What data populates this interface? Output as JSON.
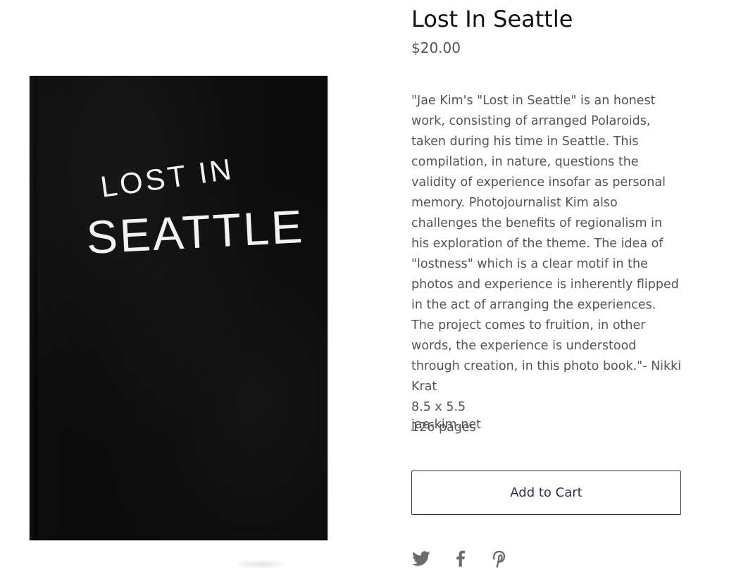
{
  "product": {
    "title": "Lost In Seattle",
    "price": "$20.00",
    "description": "\"Jae Kim's \"Lost in Seattle\" is an honest work, consisting of arranged Polaroids, taken during his time in Seattle. This compilation, in nature, questions the validity of experience insofar as personal memory. Photojournalist Kim also challenges the benefits of regionalism in his exploration of the theme. The idea of \"lostness\" which is a clear motif in the photos and experience is inherently flipped in the act of arranging the experiences. The project comes to fruition, in other words, the experience is understood through creation, in this photo book.\"- Nikki Krat",
    "dimensions": "8.5 x 5.5",
    "pages": "126 pages",
    "website": "jae-kim.net",
    "add_to_cart_label": "Add to Cart"
  },
  "cover": {
    "line1": "LOST IN",
    "line2": "SEATTLE"
  },
  "share": {
    "icons": [
      "twitter-icon",
      "facebook-icon",
      "pinterest-icon"
    ]
  },
  "colors": {
    "text_dark": "#111111",
    "text_body": "#555555",
    "button_border": "#2c2c3a",
    "button_text": "#2b3147",
    "cover_bg": "#0b0b0b",
    "icon_gray": "#6b6b6b"
  }
}
